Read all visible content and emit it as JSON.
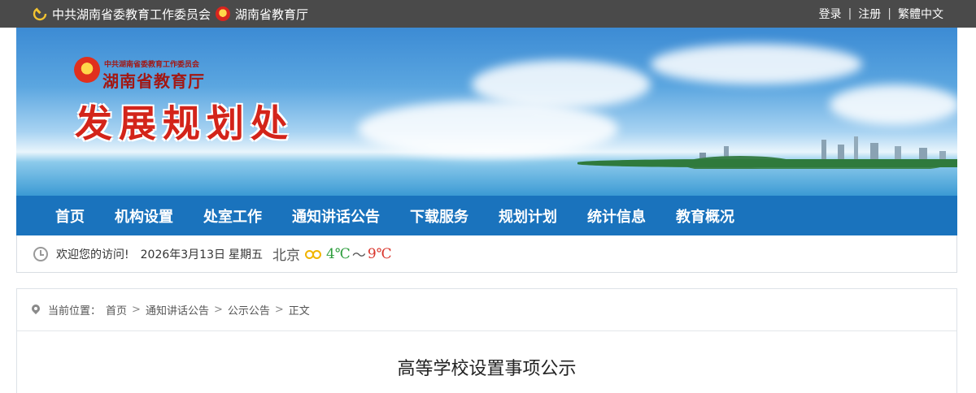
{
  "topbar": {
    "left_links": [
      "中共湖南省委教育工作委员会",
      "湖南省教育厅"
    ],
    "login": "登录",
    "separator": "|",
    "register": "注册",
    "traditional": "繁體中文"
  },
  "banner": {
    "org_small": "中共湖南省委教育工作委员会",
    "org_name": "湖南省教育厅",
    "dept_title": "发展规划处"
  },
  "nav": {
    "items": [
      "首页",
      "机构设置",
      "处室工作",
      "通知讲话公告",
      "下载服务",
      "规划计划",
      "统计信息",
      "教育概况"
    ]
  },
  "info": {
    "welcome": "欢迎您的访问!",
    "date": "2026年3月13日",
    "weekday": "星期五",
    "city": "北京",
    "temp_low": "4℃",
    "tilde": "～",
    "temp_high": "9℃",
    "weather_icon": "sun-cloud-icon"
  },
  "breadcrumb": {
    "label": "当前位置：",
    "items": [
      "首页",
      "通知讲话公告",
      "公示公告",
      "正文"
    ]
  },
  "article": {
    "title": "高等学校设置事项公示"
  }
}
